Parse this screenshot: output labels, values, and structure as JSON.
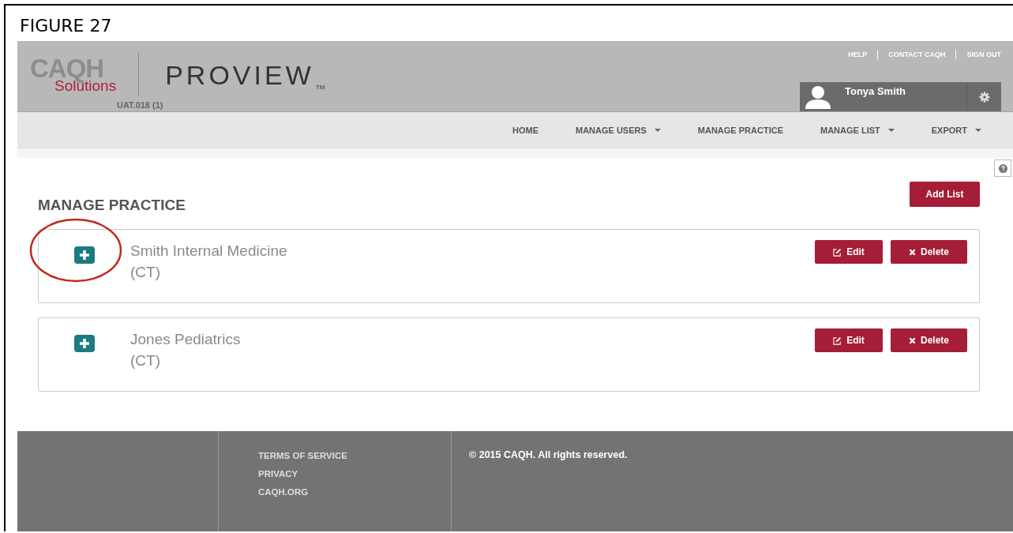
{
  "figure_label": "FIGURE 27",
  "header": {
    "logo_top": "CAQH",
    "logo_bottom": "Solutions",
    "product": "PROVIEW",
    "trademark": "TM",
    "environment": "UAT.018 (1)",
    "top_links": [
      "HELP",
      "CONTACT CAQH",
      "SIGN OUT"
    ],
    "user_name": "Tonya Smith"
  },
  "nav": [
    {
      "label": "HOME",
      "dropdown": false
    },
    {
      "label": "MANAGE USERS",
      "dropdown": true
    },
    {
      "label": "MANAGE PRACTICE",
      "dropdown": false
    },
    {
      "label": "MANAGE LIST",
      "dropdown": true
    },
    {
      "label": "EXPORT",
      "dropdown": true
    }
  ],
  "page": {
    "title": "MANAGE PRACTICE",
    "add_button": "Add List"
  },
  "practices": [
    {
      "name": "Smith Internal Medicine",
      "state": "(CT)",
      "highlighted": true,
      "edit": "Edit",
      "delete": "Delete"
    },
    {
      "name": "Jones Pediatrics",
      "state": "(CT)",
      "highlighted": false,
      "edit": "Edit",
      "delete": "Delete"
    }
  ],
  "footer": {
    "links": [
      "TERMS OF SERVICE",
      "PRIVACY",
      "CAQH.ORG"
    ],
    "copyright": "© 2015 CAQH. All rights reserved."
  }
}
